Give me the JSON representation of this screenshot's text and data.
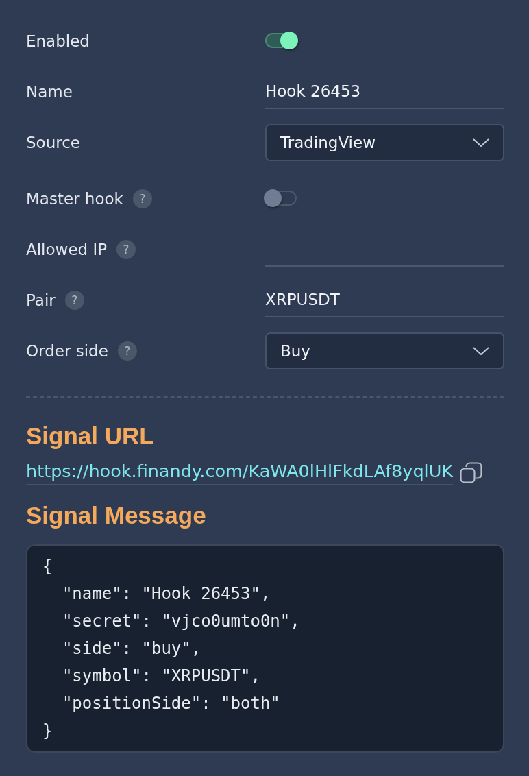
{
  "fields": [
    {
      "kind": "toggle",
      "label": "Enabled",
      "on": true
    },
    {
      "kind": "text",
      "label": "Name",
      "value": "Hook 26453"
    },
    {
      "kind": "select",
      "label": "Source",
      "value": "TradingView"
    },
    {
      "kind": "toggle",
      "label": "Master hook",
      "help": "?",
      "on": false
    },
    {
      "kind": "text",
      "label": "Allowed IP",
      "help": "?"
    },
    {
      "kind": "text",
      "label": "Pair",
      "help": "?",
      "value": "XRPUSDT"
    },
    {
      "kind": "select",
      "label": "Order side",
      "help": "?",
      "value": "Buy"
    }
  ],
  "signal_url": {
    "title": "Signal URL",
    "url": "https://hook.finandy.com/KaWA0lHlFkdLAf8yqlUK"
  },
  "signal_message": {
    "title": "Signal Message",
    "lines": [
      "{",
      "  \"name\": \"Hook 26453\",",
      "  \"secret\": \"vjco0umto0n\",",
      "  \"side\": \"buy\",",
      "  \"symbol\": \"XRPUSDT\",",
      "  \"positionSide\": \"both\"",
      "}"
    ]
  }
}
